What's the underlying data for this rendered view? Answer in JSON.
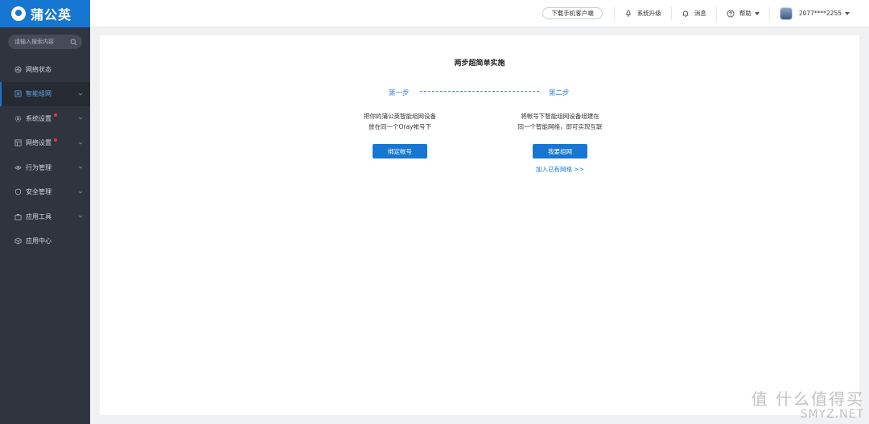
{
  "app": {
    "logo_text": "蒲公英"
  },
  "sidebar": {
    "search_placeholder": "请输入搜索内容",
    "items": [
      {
        "label": "网络状态",
        "icon": "pulse-icon",
        "has_chevron": false,
        "active": false,
        "dot": false
      },
      {
        "label": "智能组网",
        "icon": "network-icon",
        "has_chevron": true,
        "active": true,
        "dot": false
      },
      {
        "label": "系统设置",
        "icon": "gear-icon",
        "has_chevron": true,
        "active": false,
        "dot": true
      },
      {
        "label": "网络设置",
        "icon": "panel-icon",
        "has_chevron": true,
        "active": false,
        "dot": true
      },
      {
        "label": "行为管理",
        "icon": "eye-icon",
        "has_chevron": true,
        "active": false,
        "dot": false
      },
      {
        "label": "安全管理",
        "icon": "shield-icon",
        "has_chevron": true,
        "active": false,
        "dot": false
      },
      {
        "label": "应用工具",
        "icon": "toolbox-icon",
        "has_chevron": true,
        "active": false,
        "dot": false
      },
      {
        "label": "应用中心",
        "icon": "cube-icon",
        "has_chevron": false,
        "active": false,
        "dot": false
      }
    ]
  },
  "header": {
    "download_label": "下载手机客户端",
    "upgrade_label": "系统升级",
    "messages_label": "消息",
    "help_label": "帮助",
    "account_label": "2077****2255"
  },
  "main": {
    "title": "两步超简单实施",
    "step1_label": "第一步",
    "step2_label": "第二步",
    "step1_desc_line1": "把你的蒲公英智能组网设备",
    "step1_desc_line2": "放在同一个Oray帐号下",
    "step2_desc_line1": "将帐号下智能组网设备组建在",
    "step2_desc_line2": "同一个智能网络，即可实现互联",
    "bind_button": "绑定帐号",
    "network_button": "我要组网",
    "join_link": "加入已有网络 >>"
  },
  "watermark": {
    "line1": "值 什么值得买",
    "line2": "SMYZ.NET"
  },
  "colors": {
    "brand": "#1677d2",
    "sidebar_bg": "#2f343f",
    "badge": "#e8344e"
  }
}
